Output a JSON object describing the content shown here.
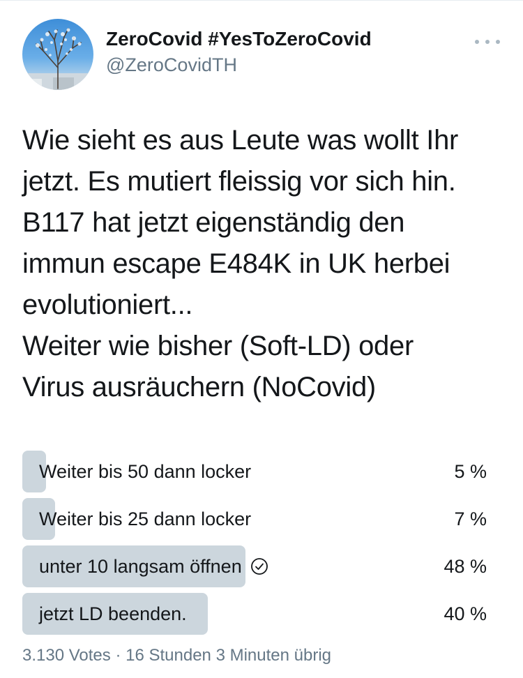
{
  "tweet": {
    "author": {
      "display_name": "ZeroCovid #YesToZeroCovid",
      "handle": "@ZeroCovidTH",
      "avatar_icon": "profile-avatar-tree"
    },
    "more_icon": "more-options-icon",
    "text_lines": [
      "Wie sieht es aus Leute was wollt Ihr",
      "jetzt. Es mutiert fleissig vor sich hin.",
      "B117 hat jetzt eigenständig den",
      "immun escape E484K in UK herbei",
      "evolutioniert...",
      "Weiter wie bisher (Soft-LD) oder",
      "Virus ausräuchern (NoCovid)"
    ]
  },
  "poll": {
    "bar_color": "#ccd6dd",
    "options": [
      {
        "label": "Weiter bis 50 dann locker",
        "percent_text": "5 %",
        "percent": 5,
        "selected": false
      },
      {
        "label": "Weiter bis 25 dann locker",
        "percent_text": "7 %",
        "percent": 7,
        "selected": false
      },
      {
        "label": "unter 10 langsam öffnen",
        "percent_text": "48 %",
        "percent": 48,
        "selected": true
      },
      {
        "label": "jetzt LD beenden.",
        "percent_text": "40 %",
        "percent": 40,
        "selected": false
      }
    ],
    "votes_text": "3.130 Votes",
    "separator": "·",
    "remaining_text": "16 Stunden 3 Minuten übrig"
  }
}
